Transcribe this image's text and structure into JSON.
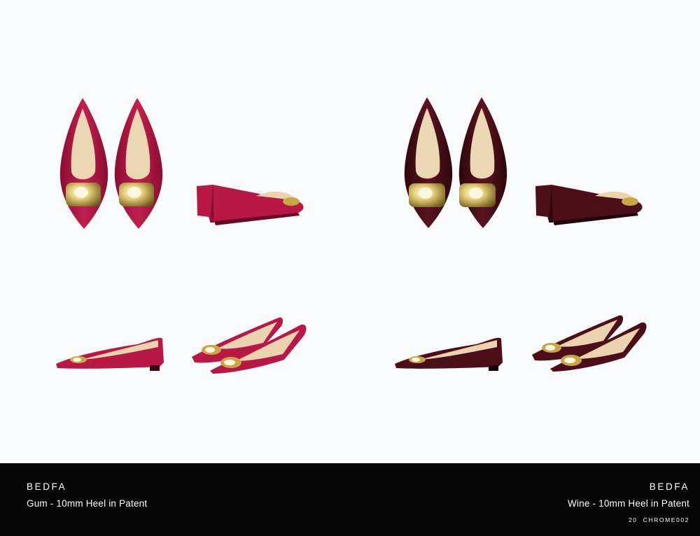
{
  "colors": {
    "background": "#f8fafb",
    "footer": "#050505",
    "gum": "#b81845",
    "gum_dark": "#8a0d32",
    "wine": "#4c0f1a",
    "wine_dark": "#2e070d",
    "gold": "#c9a646",
    "lining": "#ead3ae"
  },
  "products": [
    {
      "model": "BEDFA",
      "description": "Gum - 10mm Heel in Patent",
      "views": [
        "top-view-pair",
        "back-three-quarter",
        "side-profile",
        "front-three-quarter-pair"
      ]
    },
    {
      "model": "BEDFA",
      "description": "Wine - 10mm Heel in Patent",
      "views": [
        "top-view-pair",
        "back-three-quarter",
        "side-profile",
        "front-three-quarter-pair"
      ]
    }
  ],
  "footer": {
    "page_number": "20",
    "code": "CHROME002"
  }
}
